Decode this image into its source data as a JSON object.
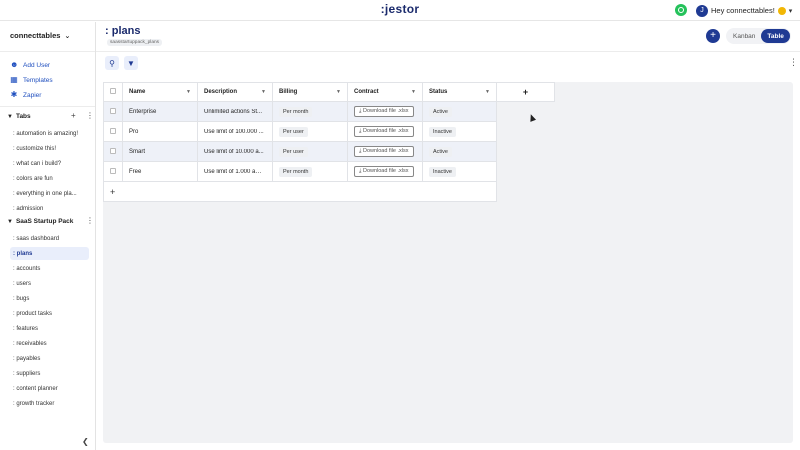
{
  "app": {
    "logo": ":jestor",
    "user_initial": "J",
    "user_greeting": "Hey connecttables!"
  },
  "sidebar": {
    "workspace": "connecttables",
    "actions": [
      {
        "label": "Add User",
        "icon": "add-user-icon"
      },
      {
        "label": "Templates",
        "icon": "templates-icon"
      },
      {
        "label": "Zapier",
        "icon": "zapier-icon"
      }
    ],
    "tabs_section": {
      "title": "Tabs",
      "items": [
        ": automation is amazing!",
        ": customize this!",
        ": what can i build?",
        ": colors are fun",
        ": everything in one pla...",
        ": admission"
      ]
    },
    "pack_section": {
      "title": "SaaS Startup Pack",
      "items": [
        ": saas dashboard",
        ": plans",
        ": accounts",
        ": users",
        ": bugs",
        ": product tasks",
        ": features",
        ": receivables",
        ": payables",
        ": suppliers",
        ": content planner",
        ": growth tracker"
      ],
      "active_index": 1
    }
  },
  "page": {
    "title": ": plans",
    "subtitle": "saasstartuppack_plans",
    "views": [
      "Kanban",
      "Table"
    ],
    "active_view": "Table"
  },
  "table": {
    "columns": [
      "Name",
      "Description",
      "Billing",
      "Contract",
      "Status"
    ],
    "rows": [
      {
        "name": "Enterprise",
        "description": "Unlimited actions St...",
        "billing": "Per month",
        "contract": "Download file .xlsx",
        "status": "Active"
      },
      {
        "name": "Pro",
        "description": "Use limit of 100.000 ...",
        "billing": "Per user",
        "contract": "Download file .xlsx",
        "status": "Inactive"
      },
      {
        "name": "Smart",
        "description": "Use limit of 10.000 a...",
        "billing": "Per user",
        "contract": "Download file .xlsx",
        "status": "Active"
      },
      {
        "name": "Free",
        "description": "Use limit of 1.000 act...",
        "billing": "Per month",
        "contract": "Download file .xlsx",
        "status": "Inactive"
      }
    ],
    "add_column": "+",
    "add_row": "+"
  }
}
